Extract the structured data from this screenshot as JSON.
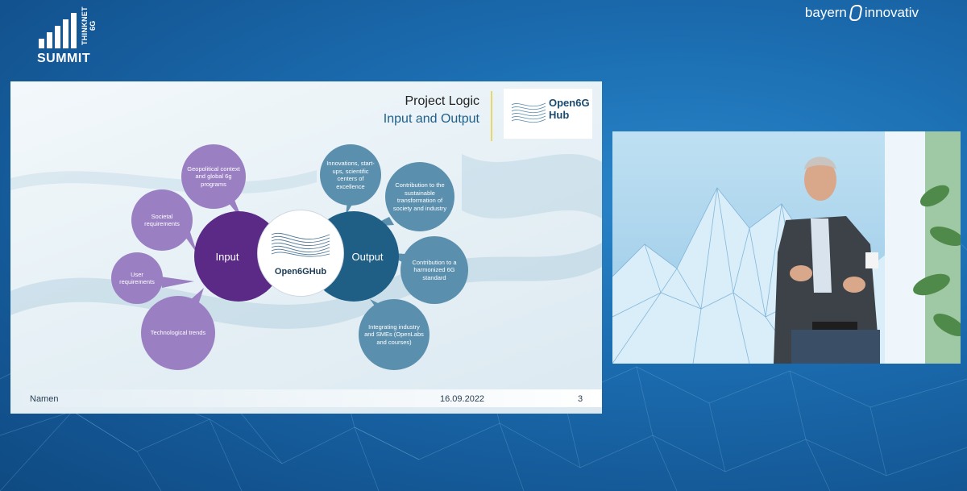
{
  "event": {
    "logo_word": "SUMMIT",
    "logo_vertical": "THINKNET 6G"
  },
  "sponsor": {
    "left": "bayern",
    "right": "innovativ"
  },
  "slide": {
    "title": "Project Logic",
    "subtitle": "Input and Output",
    "hub_logo_line1": "Open6G",
    "hub_logo_line2": "Hub",
    "center_label": "Open6GHub",
    "input_label": "Input",
    "output_label": "Output",
    "inputs": [
      "Geopolitical context and global 6g programs",
      "Societal requirements",
      "User requirements",
      "Technological trends"
    ],
    "outputs": [
      "Innovations, start-ups, scientific centers of excellence",
      "Contribution to the sustainable transformation of society and industry",
      "Contribution to a harmonized 6G standard",
      "Integrating industry and SMEs (OpenLabs and courses)"
    ],
    "footer_name": "Namen",
    "footer_date": "16.09.2022",
    "footer_page": "3"
  },
  "colors": {
    "input_circle": "#5b2a86",
    "output_circle": "#1f5f86",
    "input_bubbles": "#9b7fc3",
    "output_bubbles": "#5b8fae"
  }
}
